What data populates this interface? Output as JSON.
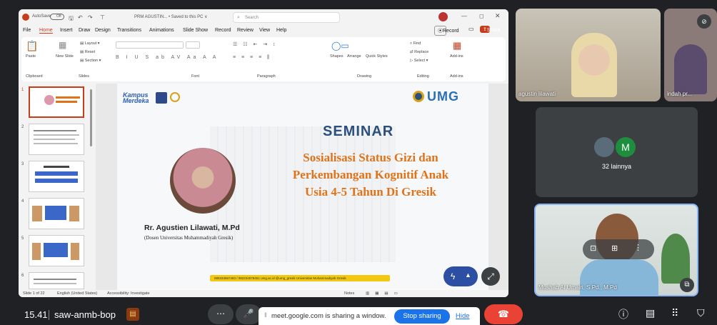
{
  "ppt": {
    "autosave": "AutoSave",
    "autosave_state": "Off",
    "doc_title": "PRM AGUSTIN... • Saved to this PC ∨",
    "search_placeholder": "Search",
    "menu": [
      "File",
      "Home",
      "Insert",
      "Draw",
      "Design",
      "Transitions",
      "Animations",
      "Slide Show",
      "Record",
      "Review",
      "View",
      "Help"
    ],
    "record_btn": "Record",
    "share_btn": "Share",
    "ribbon": {
      "paste": "Paste",
      "clipboard": "Clipboard",
      "new_slide": "New Slide",
      "layout": "Layout",
      "reset": "Reset",
      "section": "Section",
      "slides": "Slides",
      "font": "Font",
      "paragraph": "Paragraph",
      "shapes": "Shapes",
      "arrange": "Arrange",
      "quick_styles": "Quick Styles",
      "drawing": "Drawing",
      "find": "Find",
      "replace": "Replace",
      "select": "Select",
      "editing": "Editing",
      "addins": "Add-ins",
      "addins_group": "Add-ins"
    },
    "thumb_numbers": [
      "1",
      "2",
      "3",
      "4",
      "5",
      "6"
    ],
    "status": {
      "slide_of": "Slide 1 of 22",
      "language": "English (United States)",
      "accessibility": "Accessibility: Investigate",
      "notes": "Notes"
    }
  },
  "slide": {
    "logo_left": "Kampus Merdeka",
    "logo_right": "UMG",
    "heading": "SEMINAR",
    "topic_lines": [
      "Sosialisasi Status Gizi dan",
      "Perkembangan Kognitif Anak",
      "Usia 4-5 Tahun Di Gresik"
    ],
    "speaker": "Rr. Agustien Lilawati, M.Pd",
    "affiliation": "(Dosen Universitas Muhammadiyah Gresik)",
    "footer": "085334567483 / 082234578451  umg.ac.id   @umg_gresik   Universitas Muhammadiyah Gresik"
  },
  "meet": {
    "tile1_name": "agustin lilawati",
    "tile2_name": "indah pr...",
    "others_avatar_letter": "M",
    "others_label": "32 lainnya",
    "tile4_name": "Mushab Al Umairi, S.Pd., M.Pd",
    "time": "15.41",
    "meeting_code": "saw-anmb-bop",
    "sharing_text": "meet.google.com is sharing a window.",
    "stop_sharing": "Stop sharing",
    "hide": "Hide"
  },
  "colors": {
    "accent_blue": "#1a73e8",
    "end_call_red": "#ea4335",
    "share_red": "#c43e1c",
    "slide_title_blue": "#2c4f7c",
    "slide_topic_orange": "#e0731a"
  }
}
